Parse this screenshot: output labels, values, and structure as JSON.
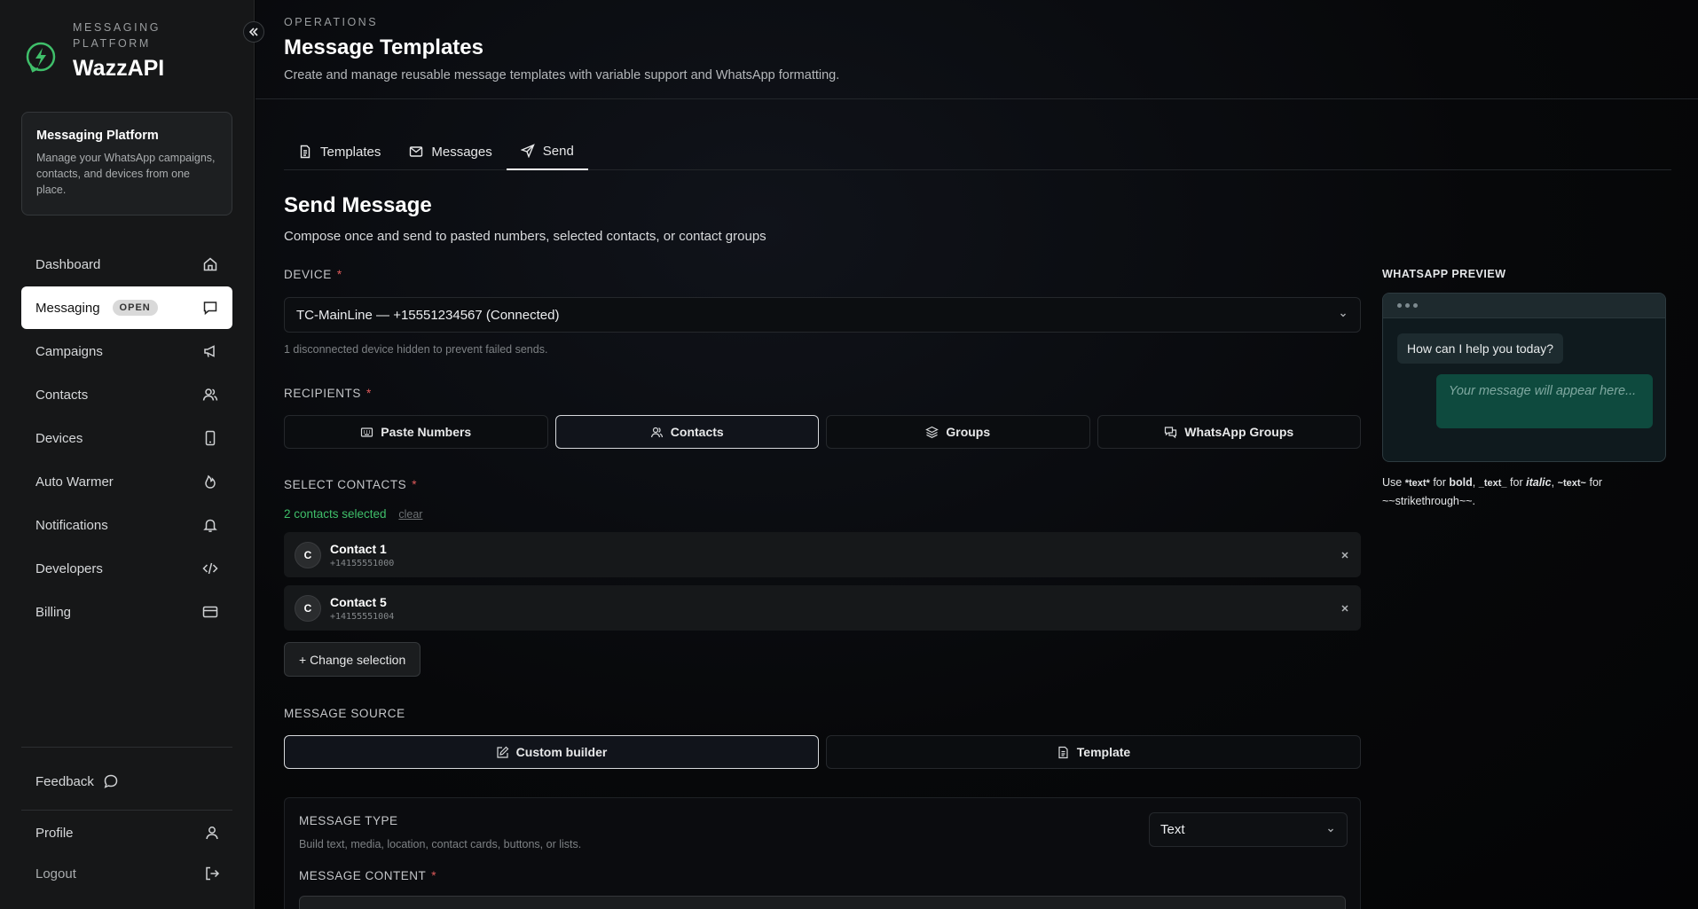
{
  "brand": {
    "eyebrow": "MESSAGING PLATFORM",
    "name": "WazzAPI",
    "accent": "#3fbf6a"
  },
  "info_card": {
    "title": "Messaging Platform",
    "description": "Manage your WhatsApp campaigns, contacts, and devices from one place."
  },
  "nav": [
    {
      "label": "Dashboard",
      "icon": "home-icon"
    },
    {
      "label": "Messaging",
      "icon": "chat-icon",
      "badge": "OPEN",
      "active": true
    },
    {
      "label": "Campaigns",
      "icon": "megaphone-icon"
    },
    {
      "label": "Contacts",
      "icon": "users-icon"
    },
    {
      "label": "Devices",
      "icon": "phone-icon"
    },
    {
      "label": "Auto Warmer",
      "icon": "flame-icon"
    },
    {
      "label": "Notifications",
      "icon": "bell-icon"
    },
    {
      "label": "Developers",
      "icon": "code-icon"
    },
    {
      "label": "Billing",
      "icon": "card-icon"
    }
  ],
  "bottom": {
    "feedback": "Feedback",
    "profile": "Profile",
    "logout": "Logout"
  },
  "header": {
    "eyebrow": "OPERATIONS",
    "title": "Message Templates",
    "subtitle": "Create and manage reusable message templates with variable support and WhatsApp formatting."
  },
  "tabs": [
    {
      "label": "Templates",
      "icon": "document-icon"
    },
    {
      "label": "Messages",
      "icon": "mail-icon"
    },
    {
      "label": "Send",
      "icon": "send-icon",
      "active": true
    }
  ],
  "send": {
    "title": "Send Message",
    "subtitle": "Compose once and send to pasted numbers, selected contacts, or contact groups",
    "device_label": "DEVICE",
    "device_value": "TC-MainLine — +15551234567 (Connected)",
    "device_hint": "1 disconnected device hidden to prevent failed sends.",
    "recipients_label": "RECIPIENTS",
    "recipient_options": [
      "Paste Numbers",
      "Contacts",
      "Groups",
      "WhatsApp Groups"
    ],
    "recipient_selected": "Contacts",
    "select_contacts_label": "SELECT CONTACTS",
    "selected_count_text": "2 contacts selected",
    "clear_label": "clear",
    "contacts": [
      {
        "initial": "C",
        "name": "Contact 1",
        "phone": "+14155551000"
      },
      {
        "initial": "C",
        "name": "Contact 5",
        "phone": "+14155551004"
      }
    ],
    "change_selection": "+ Change selection",
    "message_source_label": "MESSAGE SOURCE",
    "source_options": [
      "Custom builder",
      "Template"
    ],
    "source_selected": "Custom builder",
    "message_type_label": "MESSAGE TYPE",
    "message_type_hint": "Build text, media, location, contact cards, buttons, or lists.",
    "message_type_value": "Text",
    "message_content_label": "MESSAGE CONTENT",
    "required_mark": "*"
  },
  "preview": {
    "label": "WHATSAPP PREVIEW",
    "incoming": "How can I help you today?",
    "outgoing_placeholder": "Your message will appear here...",
    "note_prefix": "Use",
    "note_bold_code": "*text*",
    "note_for1": "for",
    "note_bold": "bold",
    "note_italic_code": "_text_",
    "note_for2": "for",
    "note_italic": "italic",
    "note_strike_code": "~text~",
    "note_for3": "for",
    "note_strike": "~~strikethrough~~."
  }
}
